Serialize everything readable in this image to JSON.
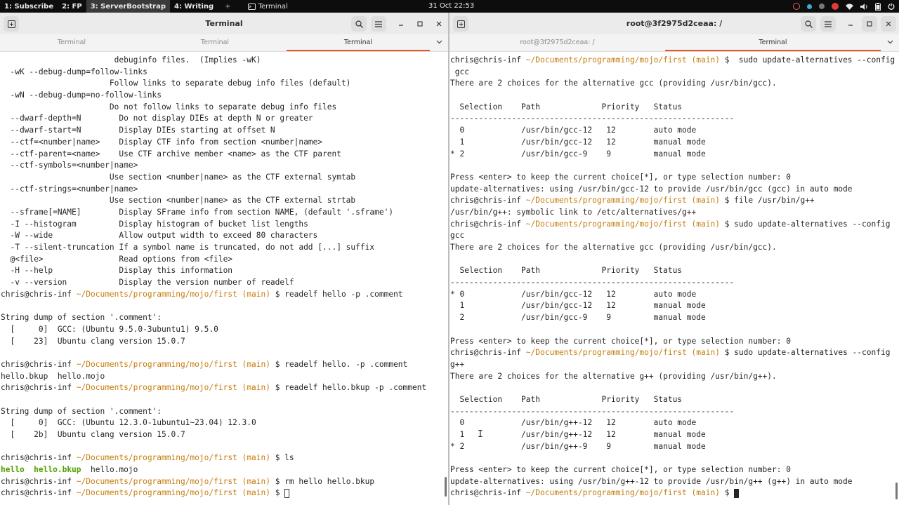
{
  "topbar": {
    "workspaces": [
      {
        "label": "1: Subscribe",
        "active": false
      },
      {
        "label": "2: FP",
        "active": false
      },
      {
        "label": "3: ServerBootstrap",
        "active": true
      },
      {
        "label": "4: Writing",
        "active": false
      }
    ],
    "add_label": "+",
    "app_label": "Terminal",
    "clock": "31 Oct  22:53"
  },
  "left_window": {
    "title": "Terminal",
    "tabs": [
      "Terminal",
      "Terminal",
      "Terminal"
    ],
    "active_tab": 2,
    "lines": [
      {
        "t": "                        debuginfo files.  (Implies -wK)"
      },
      {
        "t": "  -wK --debug-dump=follow-links"
      },
      {
        "t": "                       Follow links to separate debug info files (default)"
      },
      {
        "t": "  -wN --debug-dump=no-follow-links"
      },
      {
        "t": "                       Do not follow links to separate debug info files"
      },
      {
        "t": "  --dwarf-depth=N        Do not display DIEs at depth N or greater"
      },
      {
        "t": "  --dwarf-start=N        Display DIEs starting at offset N"
      },
      {
        "t": "  --ctf=<number|name>    Display CTF info from section <number|name>"
      },
      {
        "t": "  --ctf-parent=<name>    Use CTF archive member <name> as the CTF parent"
      },
      {
        "t": "  --ctf-symbols=<number|name>"
      },
      {
        "t": "                       Use section <number|name> as the CTF external symtab"
      },
      {
        "t": "  --ctf-strings=<number|name>"
      },
      {
        "t": "                       Use section <number|name> as the CTF external strtab"
      },
      {
        "t": "  --sframe[=NAME]        Display SFrame info from section NAME, (default '.sframe')"
      },
      {
        "t": "  -I --histogram         Display histogram of bucket list lengths"
      },
      {
        "t": "  -W --wide              Allow output width to exceed 80 characters"
      },
      {
        "t": "  -T --silent-truncation If a symbol name is truncated, do not add [...] suffix"
      },
      {
        "t": "  @<file>                Read options from <file>"
      },
      {
        "t": "  -H --help              Display this information"
      },
      {
        "t": "  -v --version           Display the version number of readelf"
      },
      {
        "p": true,
        "user": "chris@chris-inf",
        "path": " ~/Documents/programming/mojo/first",
        "branch": " (main)",
        "cmd": " $ readelf hello -p .comment"
      },
      {
        "t": ""
      },
      {
        "t": "String dump of section '.comment':"
      },
      {
        "t": "  [     0]  GCC: (Ubuntu 9.5.0-3ubuntu1) 9.5.0"
      },
      {
        "t": "  [    23]  Ubuntu clang version 15.0.7"
      },
      {
        "t": ""
      },
      {
        "p": true,
        "user": "chris@chris-inf",
        "path": " ~/Documents/programming/mojo/first",
        "branch": " (main)",
        "cmd": " $ readelf hello. -p .comment"
      },
      {
        "t": "hello.bkup  hello.mojo"
      },
      {
        "p": true,
        "user": "chris@chris-inf",
        "path": " ~/Documents/programming/mojo/first",
        "branch": " (main)",
        "cmd": " $ readelf hello.bkup -p .comment"
      },
      {
        "t": ""
      },
      {
        "t": "String dump of section '.comment':"
      },
      {
        "t": "  [     0]  GCC: (Ubuntu 12.3.0-1ubuntu1~23.04) 12.3.0"
      },
      {
        "t": "  [    2b]  Ubuntu clang version 15.0.7"
      },
      {
        "t": ""
      },
      {
        "p": true,
        "user": "chris@chris-inf",
        "path": " ~/Documents/programming/mojo/first",
        "branch": " (main)",
        "cmd": " $ ls"
      },
      {
        "ls": true,
        "exe1": "hello",
        "exe2": "hello.bkup",
        "rest": "hello.mojo"
      },
      {
        "p": true,
        "user": "chris@chris-inf",
        "path": " ~/Documents/programming/mojo/first",
        "branch": " (main)",
        "cmd": " $ rm hello hello.bkup"
      },
      {
        "p": true,
        "user": "chris@chris-inf",
        "path": " ~/Documents/programming/mojo/first",
        "branch": " (main)",
        "cmd": " $ ",
        "cursor": "hollow"
      }
    ]
  },
  "right_window": {
    "title": "root@3f2975d2ceaa: /",
    "tabs": [
      "root@3f2975d2ceaa: /",
      "Terminal"
    ],
    "active_tab": 1,
    "lines": [
      {
        "p": true,
        "user": "chris@chris-inf",
        "path": " ~/Documents/programming/mojo/first",
        "branch": " (main)",
        "cmd": " $  sudo update-alternatives --config"
      },
      {
        "t": " gcc"
      },
      {
        "t": "There are 2 choices for the alternative gcc (providing /usr/bin/gcc)."
      },
      {
        "t": ""
      },
      {
        "t": "  Selection    Path             Priority   Status"
      },
      {
        "t": "------------------------------------------------------------"
      },
      {
        "t": "  0            /usr/bin/gcc-12   12        auto mode"
      },
      {
        "t": "  1            /usr/bin/gcc-12   12        manual mode"
      },
      {
        "t": "* 2            /usr/bin/gcc-9    9         manual mode"
      },
      {
        "t": ""
      },
      {
        "t": "Press <enter> to keep the current choice[*], or type selection number: 0"
      },
      {
        "t": "update-alternatives: using /usr/bin/gcc-12 to provide /usr/bin/gcc (gcc) in auto mode"
      },
      {
        "p": true,
        "user": "chris@chris-inf",
        "path": " ~/Documents/programming/mojo/first",
        "branch": " (main)",
        "cmd": " $ file /usr/bin/g++"
      },
      {
        "t": "/usr/bin/g++: symbolic link to /etc/alternatives/g++"
      },
      {
        "p": true,
        "user": "chris@chris-inf",
        "path": " ~/Documents/programming/mojo/first",
        "branch": " (main)",
        "cmd": " $ sudo update-alternatives --config"
      },
      {
        "t": "gcc"
      },
      {
        "t": "There are 2 choices for the alternative gcc (providing /usr/bin/gcc)."
      },
      {
        "t": ""
      },
      {
        "t": "  Selection    Path             Priority   Status"
      },
      {
        "t": "------------------------------------------------------------"
      },
      {
        "t": "* 0            /usr/bin/gcc-12   12        auto mode"
      },
      {
        "t": "  1            /usr/bin/gcc-12   12        manual mode"
      },
      {
        "t": "  2            /usr/bin/gcc-9    9         manual mode"
      },
      {
        "t": ""
      },
      {
        "t": "Press <enter> to keep the current choice[*], or type selection number: 0"
      },
      {
        "p": true,
        "user": "chris@chris-inf",
        "path": " ~/Documents/programming/mojo/first",
        "branch": " (main)",
        "cmd": " $ sudo update-alternatives --config"
      },
      {
        "t": "g++"
      },
      {
        "t": "There are 2 choices for the alternative g++ (providing /usr/bin/g++)."
      },
      {
        "t": ""
      },
      {
        "t": "  Selection    Path             Priority   Status"
      },
      {
        "t": "------------------------------------------------------------"
      },
      {
        "t": "  0            /usr/bin/g++-12   12        auto mode"
      },
      {
        "t": "  1            /usr/bin/g++-12   12        manual mode"
      },
      {
        "t": "* 2            /usr/bin/g++-9    9         manual mode"
      },
      {
        "t": ""
      },
      {
        "t": "Press <enter> to keep the current choice[*], or type selection number: 0"
      },
      {
        "t": "update-alternatives: using /usr/bin/g++-12 to provide /usr/bin/g++ (g++) in auto mode"
      },
      {
        "p": true,
        "user": "chris@chris-inf",
        "path": " ~/Documents/programming/mojo/first",
        "branch": " (main)",
        "cmd": " $ ",
        "cursor": "block"
      }
    ]
  },
  "icons": {
    "new_tab": "new-tab-icon",
    "search": "search-icon",
    "menu": "hamburger-menu-icon",
    "minimize": "minimize-icon",
    "maximize": "maximize-icon",
    "close": "close-icon",
    "tabs_dropdown": "chevron-down-icon"
  }
}
